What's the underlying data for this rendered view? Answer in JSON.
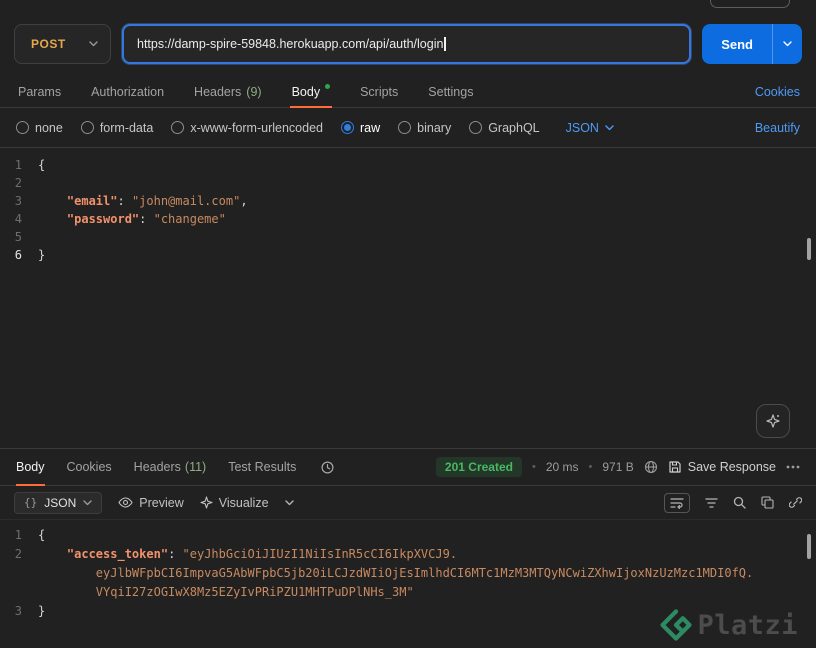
{
  "colors": {
    "accent": "#0d6ce0",
    "link": "#4e9af5",
    "method": "#e8a64d",
    "brand": "#ff6c37",
    "success": "#2ea44f",
    "status": "#4ab763",
    "key": "#f2926c",
    "str": "#c88a60",
    "punct": "#d6d6d6",
    "ln": "#6e6e6e",
    "platzi": "#2f9e6e"
  },
  "topbar": {
    "method": "POST",
    "url": "https://damp-spire-59848.herokuapp.com/api/auth/login",
    "send": "Send"
  },
  "request_tabs": {
    "params": "Params",
    "authorization": "Authorization",
    "headers": "Headers",
    "headers_count": "(9)",
    "body": "Body",
    "scripts": "Scripts",
    "settings": "Settings",
    "cookies": "Cookies"
  },
  "body_options": {
    "none": "none",
    "form_data": "form-data",
    "urlencoded": "x-www-form-urlencoded",
    "raw": "raw",
    "binary": "binary",
    "graphql": "GraphQL",
    "language": "JSON",
    "beautify": "Beautify"
  },
  "request_editor": {
    "lines": [
      {
        "num": "1",
        "tokens": [
          {
            "c": "p",
            "t": "{"
          }
        ]
      },
      {
        "num": "2",
        "tokens": []
      },
      {
        "num": "3",
        "tokens": [
          {
            "c": "w",
            "t": "    "
          },
          {
            "c": "k",
            "t": "\"email\""
          },
          {
            "c": "p",
            "t": ": "
          },
          {
            "c": "s",
            "t": "\"john@mail.com\""
          },
          {
            "c": "p",
            "t": ","
          }
        ]
      },
      {
        "num": "4",
        "tokens": [
          {
            "c": "w",
            "t": "    "
          },
          {
            "c": "k",
            "t": "\"password\""
          },
          {
            "c": "p",
            "t": ": "
          },
          {
            "c": "s",
            "t": "\"changeme\""
          }
        ]
      },
      {
        "num": "5",
        "tokens": []
      },
      {
        "num": "6",
        "active": true,
        "tokens": [
          {
            "c": "p",
            "t": "}"
          }
        ]
      }
    ]
  },
  "response_tabs": {
    "body": "Body",
    "cookies": "Cookies",
    "headers": "Headers",
    "headers_count": "(11)",
    "tests": "Test Results"
  },
  "response_meta": {
    "status": "201 Created",
    "time": "20 ms",
    "size": "971 B",
    "save": "Save Response"
  },
  "response_toolbar": {
    "braces": "{}",
    "format": "JSON",
    "preview": "Preview",
    "visualize": "Visualize"
  },
  "response_editor": {
    "lines": [
      {
        "num": "1",
        "tokens": [
          {
            "c": "p",
            "t": "{"
          }
        ]
      },
      {
        "num": "2",
        "tokens": [
          {
            "c": "w",
            "t": "    "
          },
          {
            "c": "k",
            "t": "\"access_token\""
          },
          {
            "c": "p",
            "t": ": "
          },
          {
            "c": "s",
            "t": "\"eyJhbGciOiJIUzI1NiIsInR5cCI6IkpXVCJ9."
          }
        ]
      },
      {
        "num": "",
        "tokens": [
          {
            "c": "w",
            "t": "        "
          },
          {
            "c": "s",
            "t": "eyJlbWFpbCI6ImpvaG5AbWFpbC5jb20iLCJzdWIiOjEsImlhdCI6MTc1MzM3MTQyNCwiZXhwIjoxNzUzMzc1MDI0fQ."
          }
        ]
      },
      {
        "num": "",
        "tokens": [
          {
            "c": "w",
            "t": "        "
          },
          {
            "c": "s",
            "t": "VYqiI27zOGIwX8Mz5EZyIvPRiPZU1MHTPuDPlNHs_3M\""
          }
        ]
      },
      {
        "num": "3",
        "tokens": [
          {
            "c": "p",
            "t": "}"
          }
        ]
      }
    ]
  },
  "watermark": {
    "brand": "Platzi"
  }
}
